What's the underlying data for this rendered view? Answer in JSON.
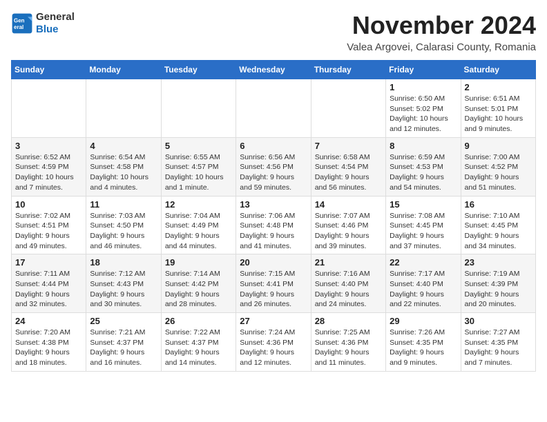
{
  "header": {
    "logo": {
      "general": "General",
      "blue": "Blue"
    },
    "title": "November 2024",
    "subtitle": "Valea Argovei, Calarasi County, Romania"
  },
  "calendar": {
    "days_of_week": [
      "Sunday",
      "Monday",
      "Tuesday",
      "Wednesday",
      "Thursday",
      "Friday",
      "Saturday"
    ],
    "weeks": [
      [
        {
          "day": "",
          "info": ""
        },
        {
          "day": "",
          "info": ""
        },
        {
          "day": "",
          "info": ""
        },
        {
          "day": "",
          "info": ""
        },
        {
          "day": "",
          "info": ""
        },
        {
          "day": "1",
          "info": "Sunrise: 6:50 AM\nSunset: 5:02 PM\nDaylight: 10 hours and 12 minutes."
        },
        {
          "day": "2",
          "info": "Sunrise: 6:51 AM\nSunset: 5:01 PM\nDaylight: 10 hours and 9 minutes."
        }
      ],
      [
        {
          "day": "3",
          "info": "Sunrise: 6:52 AM\nSunset: 4:59 PM\nDaylight: 10 hours and 7 minutes."
        },
        {
          "day": "4",
          "info": "Sunrise: 6:54 AM\nSunset: 4:58 PM\nDaylight: 10 hours and 4 minutes."
        },
        {
          "day": "5",
          "info": "Sunrise: 6:55 AM\nSunset: 4:57 PM\nDaylight: 10 hours and 1 minute."
        },
        {
          "day": "6",
          "info": "Sunrise: 6:56 AM\nSunset: 4:56 PM\nDaylight: 9 hours and 59 minutes."
        },
        {
          "day": "7",
          "info": "Sunrise: 6:58 AM\nSunset: 4:54 PM\nDaylight: 9 hours and 56 minutes."
        },
        {
          "day": "8",
          "info": "Sunrise: 6:59 AM\nSunset: 4:53 PM\nDaylight: 9 hours and 54 minutes."
        },
        {
          "day": "9",
          "info": "Sunrise: 7:00 AM\nSunset: 4:52 PM\nDaylight: 9 hours and 51 minutes."
        }
      ],
      [
        {
          "day": "10",
          "info": "Sunrise: 7:02 AM\nSunset: 4:51 PM\nDaylight: 9 hours and 49 minutes."
        },
        {
          "day": "11",
          "info": "Sunrise: 7:03 AM\nSunset: 4:50 PM\nDaylight: 9 hours and 46 minutes."
        },
        {
          "day": "12",
          "info": "Sunrise: 7:04 AM\nSunset: 4:49 PM\nDaylight: 9 hours and 44 minutes."
        },
        {
          "day": "13",
          "info": "Sunrise: 7:06 AM\nSunset: 4:48 PM\nDaylight: 9 hours and 41 minutes."
        },
        {
          "day": "14",
          "info": "Sunrise: 7:07 AM\nSunset: 4:46 PM\nDaylight: 9 hours and 39 minutes."
        },
        {
          "day": "15",
          "info": "Sunrise: 7:08 AM\nSunset: 4:45 PM\nDaylight: 9 hours and 37 minutes."
        },
        {
          "day": "16",
          "info": "Sunrise: 7:10 AM\nSunset: 4:45 PM\nDaylight: 9 hours and 34 minutes."
        }
      ],
      [
        {
          "day": "17",
          "info": "Sunrise: 7:11 AM\nSunset: 4:44 PM\nDaylight: 9 hours and 32 minutes."
        },
        {
          "day": "18",
          "info": "Sunrise: 7:12 AM\nSunset: 4:43 PM\nDaylight: 9 hours and 30 minutes."
        },
        {
          "day": "19",
          "info": "Sunrise: 7:14 AM\nSunset: 4:42 PM\nDaylight: 9 hours and 28 minutes."
        },
        {
          "day": "20",
          "info": "Sunrise: 7:15 AM\nSunset: 4:41 PM\nDaylight: 9 hours and 26 minutes."
        },
        {
          "day": "21",
          "info": "Sunrise: 7:16 AM\nSunset: 4:40 PM\nDaylight: 9 hours and 24 minutes."
        },
        {
          "day": "22",
          "info": "Sunrise: 7:17 AM\nSunset: 4:40 PM\nDaylight: 9 hours and 22 minutes."
        },
        {
          "day": "23",
          "info": "Sunrise: 7:19 AM\nSunset: 4:39 PM\nDaylight: 9 hours and 20 minutes."
        }
      ],
      [
        {
          "day": "24",
          "info": "Sunrise: 7:20 AM\nSunset: 4:38 PM\nDaylight: 9 hours and 18 minutes."
        },
        {
          "day": "25",
          "info": "Sunrise: 7:21 AM\nSunset: 4:37 PM\nDaylight: 9 hours and 16 minutes."
        },
        {
          "day": "26",
          "info": "Sunrise: 7:22 AM\nSunset: 4:37 PM\nDaylight: 9 hours and 14 minutes."
        },
        {
          "day": "27",
          "info": "Sunrise: 7:24 AM\nSunset: 4:36 PM\nDaylight: 9 hours and 12 minutes."
        },
        {
          "day": "28",
          "info": "Sunrise: 7:25 AM\nSunset: 4:36 PM\nDaylight: 9 hours and 11 minutes."
        },
        {
          "day": "29",
          "info": "Sunrise: 7:26 AM\nSunset: 4:35 PM\nDaylight: 9 hours and 9 minutes."
        },
        {
          "day": "30",
          "info": "Sunrise: 7:27 AM\nSunset: 4:35 PM\nDaylight: 9 hours and 7 minutes."
        }
      ]
    ]
  }
}
